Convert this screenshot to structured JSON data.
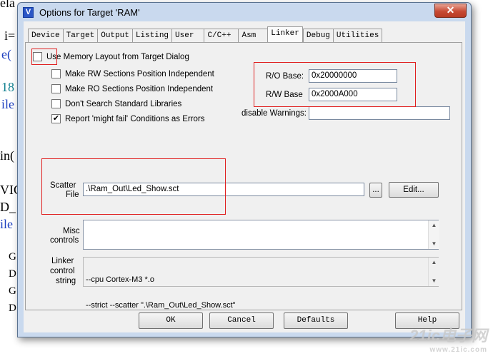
{
  "background": {
    "lines": [
      "ela",
      "i=",
      "e(",
      "18",
      "ile",
      "in(",
      "VIC",
      "D_",
      "ile",
      "G",
      "D",
      "G",
      "D"
    ]
  },
  "window": {
    "title": "Options for Target 'RAM'",
    "icon_letter": "V",
    "close_label": "✕"
  },
  "tabs": [
    {
      "label": "Device"
    },
    {
      "label": "Target"
    },
    {
      "label": "Output"
    },
    {
      "label": "Listing"
    },
    {
      "label": "User"
    },
    {
      "label": "C/C++"
    },
    {
      "label": "Asm"
    },
    {
      "label": "Linker"
    },
    {
      "label": "Debug"
    },
    {
      "label": "Utilities"
    }
  ],
  "active_tab": "Linker",
  "linker": {
    "use_memory_layout": {
      "label": "Use Memory Layout from Target Dialog",
      "checked": false
    },
    "rw_independent": {
      "label": "Make RW Sections Position Independent",
      "checked": false
    },
    "ro_independent": {
      "label": "Make RO Sections Position Independent",
      "checked": false
    },
    "no_std_libs": {
      "label": "Don't Search Standard Libraries",
      "checked": false
    },
    "might_fail": {
      "label": "Report 'might fail' Conditions as Errors",
      "checked": true
    },
    "ro_base_label": "R/O Base:",
    "ro_base_value": "0x20000000",
    "rw_base_label": "R/W Base",
    "rw_base_value": "0x2000A000",
    "disable_warnings_label": "disable Warnings:",
    "disable_warnings_value": "",
    "scatter_label_1": "Scatter",
    "scatter_label_2": "File",
    "scatter_value": ".\\Ram_Out\\Led_Show.sct",
    "browse_label": "...",
    "edit_label": "Edit...",
    "misc_label_1": "Misc",
    "misc_label_2": "controls",
    "misc_value": "",
    "string_label_1": "Linker",
    "string_label_2": "control",
    "string_label_3": "string",
    "string_line_1": "--cpu Cortex-M3 *.o",
    "string_line_2": "--strict --scatter \".\\Ram_Out\\Led_Show.sct\""
  },
  "footer": {
    "ok": "OK",
    "cancel": "Cancel",
    "defaults": "Defaults",
    "help": "Help"
  },
  "watermark": {
    "main": "21ic电子网",
    "sub": "www.21ic.com"
  },
  "colors": {
    "highlight": "#e02020",
    "title_bar": "#c9d9ee",
    "close": "#c74a34"
  }
}
